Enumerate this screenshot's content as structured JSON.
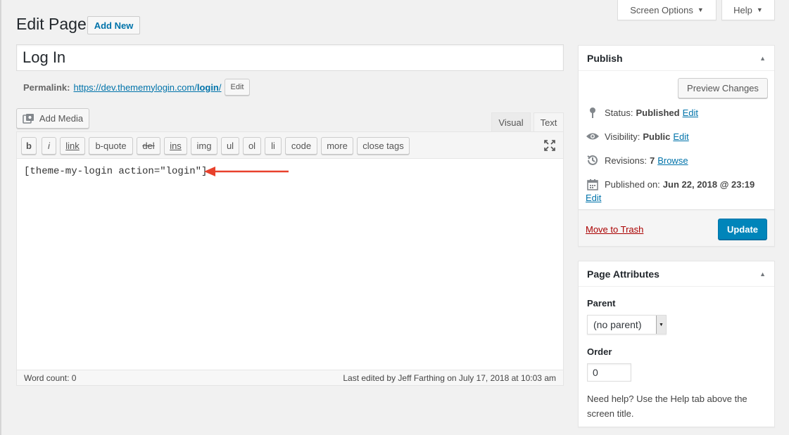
{
  "screen_meta": {
    "screen_options": "Screen Options",
    "help": "Help"
  },
  "header": {
    "title": "Edit Page",
    "add_new": "Add New"
  },
  "post": {
    "title": "Log In",
    "permalink_label": "Permalink:",
    "permalink_base": "https://dev.thememylogin.com/",
    "permalink_slug": "login",
    "permalink_trail": "/",
    "permalink_edit": "Edit"
  },
  "editor": {
    "add_media": "Add Media",
    "tabs": {
      "visual": "Visual",
      "text": "Text"
    },
    "quicktags": [
      "b",
      "i",
      "link",
      "b-quote",
      "del",
      "ins",
      "img",
      "ul",
      "ol",
      "li",
      "code",
      "more",
      "close tags"
    ],
    "content": "[theme-my-login action=\"login\"]",
    "word_count": "Word count: 0",
    "last_edited": "Last edited by Jeff Farthing on July 17, 2018 at 10:03 am",
    "arrow_color": "#e8412c"
  },
  "publish": {
    "title": "Publish",
    "preview": "Preview Changes",
    "status_label": "Status:",
    "status_value": "Published",
    "status_edit": "Edit",
    "visibility_label": "Visibility:",
    "visibility_value": "Public",
    "visibility_edit": "Edit",
    "revisions_label": "Revisions:",
    "revisions_value": "7",
    "revisions_browse": "Browse",
    "published_label": "Published on:",
    "published_value": "Jun 22, 2018 @ 23:19",
    "published_edit": "Edit",
    "trash": "Move to Trash",
    "update": "Update"
  },
  "page_attributes": {
    "title": "Page Attributes",
    "parent_label": "Parent",
    "parent_value": "(no parent)",
    "order_label": "Order",
    "order_value": "0",
    "help": "Need help? Use the Help tab above the screen title."
  },
  "colors": {
    "accent": "#0073aa",
    "primary_button": "#0085ba",
    "trash": "#a00"
  }
}
